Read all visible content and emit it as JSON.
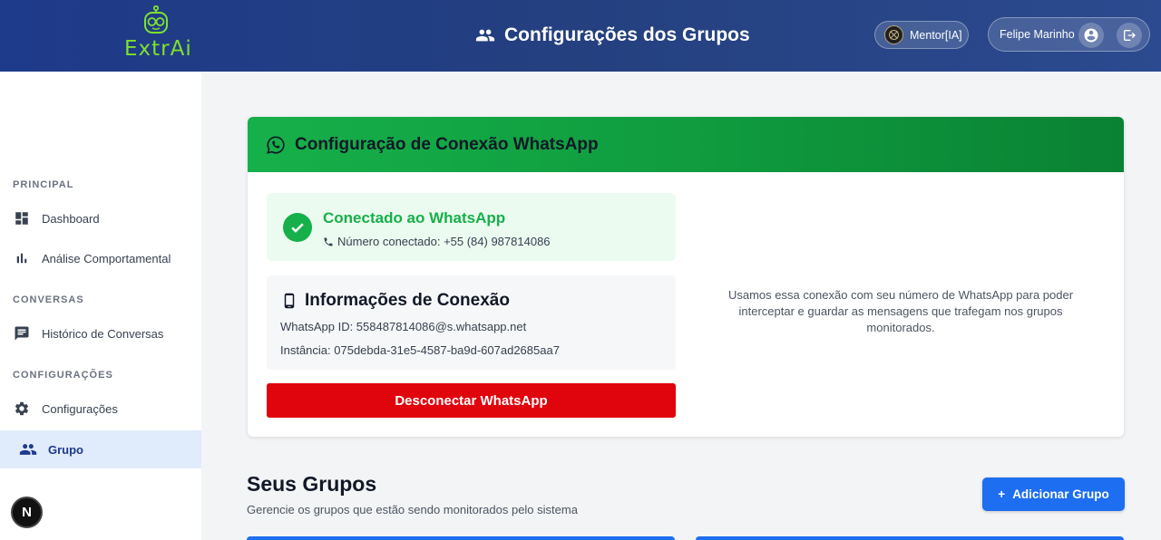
{
  "header": {
    "logo_text": "ExtrAi",
    "title": "Configurações dos Grupos",
    "mentor_label": "Mentor[IA]",
    "user_name": "Felipe Marinho"
  },
  "sidebar": {
    "sections": [
      {
        "label": "PRINCIPAL",
        "items": [
          {
            "label": "Dashboard",
            "icon": "dashboard-icon"
          },
          {
            "label": "Análise Comportamental",
            "icon": "bar-chart-icon"
          }
        ]
      },
      {
        "label": "CONVERSAS",
        "items": [
          {
            "label": "Histórico de Conversas",
            "icon": "chat-icon"
          }
        ]
      },
      {
        "label": "CONFIGURAÇÕES",
        "items": [
          {
            "label": "Configurações",
            "icon": "gear-icon"
          },
          {
            "label": "Grupo",
            "icon": "group-icon",
            "active": true
          }
        ]
      }
    ],
    "badge": "N"
  },
  "connection": {
    "title": "Configuração de Conexão WhatsApp",
    "status_title": "Conectado ao WhatsApp",
    "status_number": "Número conectado: +55 (84) 987814086",
    "info_title": "Informações de Conexão",
    "whatsapp_id": "WhatsApp ID: 558487814086@s.whatsapp.net",
    "instance": "Instância: 075debda-31e5-4587-ba9d-607ad2685aa7",
    "disconnect_label": "Desconectar WhatsApp",
    "note": "Usamos essa conexão com seu número de WhatsApp para poder interceptar e guardar as mensagens que trafegam nos grupos monitorados."
  },
  "groups": {
    "title": "Seus Grupos",
    "subtitle": "Gerencie os grupos que estão sendo monitorados pelo sistema",
    "add_label": "Adicionar Grupo"
  },
  "colors": {
    "header": "#1e3a8a",
    "whatsapp_green": "#16b04a",
    "danger": "#e0040d",
    "primary": "#1d6ef0",
    "logo": "#7ee12c"
  }
}
